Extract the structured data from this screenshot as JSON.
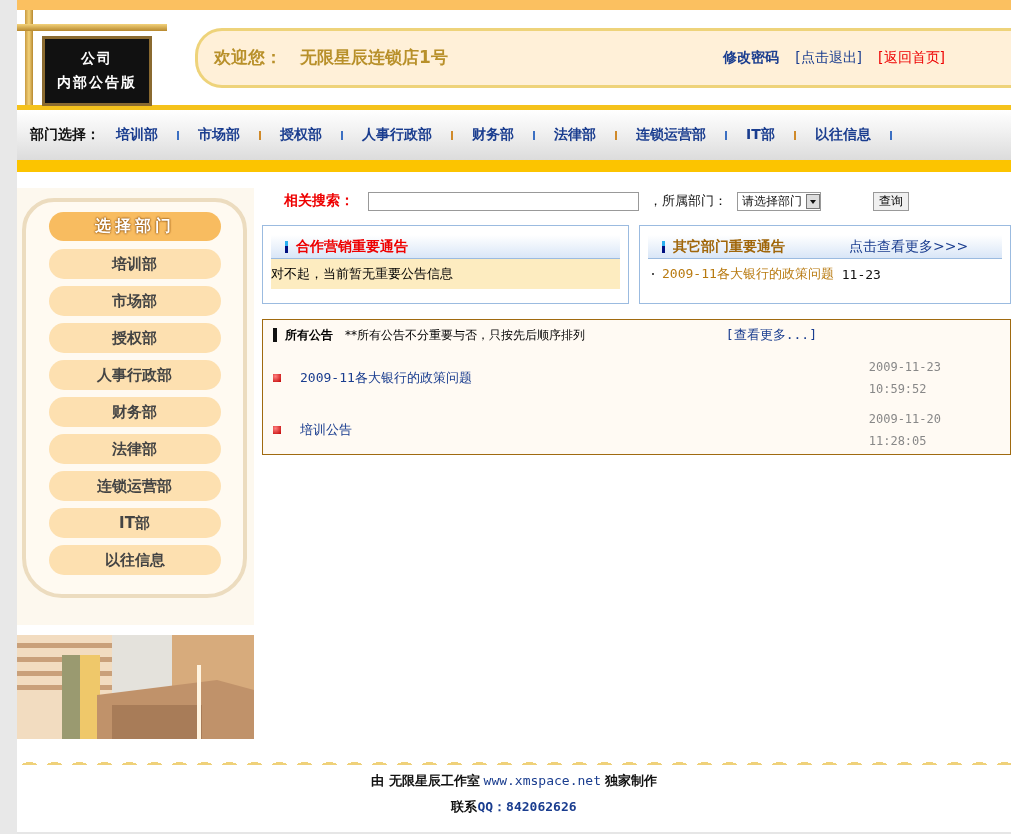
{
  "header": {
    "logo_lines": [
      "公司",
      "内部公告版"
    ],
    "welcome_label": "欢迎您：",
    "store_name": "无限星辰连锁店1号",
    "links": [
      {
        "label": "修改密码",
        "kind": "bold"
      },
      {
        "label": "[点击退出]",
        "kind": "plain"
      },
      {
        "label": "[返回首页]",
        "kind": "alert"
      }
    ]
  },
  "nav": {
    "label": "部门选择：",
    "items": [
      "培训部",
      "市场部",
      "授权部",
      "人事行政部",
      "财务部",
      "法律部",
      "连锁运营部",
      "IT部",
      "以往信息"
    ]
  },
  "sidebar": {
    "title": "选择部门",
    "items": [
      "培训部",
      "市场部",
      "授权部",
      "人事行政部",
      "财务部",
      "法律部",
      "连锁运营部",
      "IT部",
      "以往信息"
    ]
  },
  "search": {
    "label": "相关搜索：",
    "department_label": "，所属部门：",
    "department_select": "请选择部门",
    "button": "查询"
  },
  "panels": [
    {
      "kind": "empty",
      "title": "合作营销重要通告",
      "message": "对不起，当前暂无重要公告信息"
    },
    {
      "kind": "list",
      "title": "其它部门重要通告",
      "more": "点击查看更多>>>",
      "items": [
        {
          "title": "2009-11各大银行的政策问题",
          "date": "11-23"
        }
      ]
    }
  ],
  "all_notices": {
    "title": "所有公告",
    "note": "**所有公告不分重要与否，只按先后顺序排列",
    "more": "[查看更多...]",
    "rows": [
      {
        "title": "2009-11各大银行的政策问题",
        "date": "2009-11-23",
        "time": "10:59:52"
      },
      {
        "title": "培训公告",
        "date": "2009-11-20",
        "time": "11:28:05"
      }
    ]
  },
  "footer": {
    "credit_prefix": "由 无限星辰工作室",
    "credit_link": "www.xmspace.net",
    "credit_suffix": "独家制作",
    "contact_label": "联系",
    "contact_value": "QQ：842062626"
  }
}
